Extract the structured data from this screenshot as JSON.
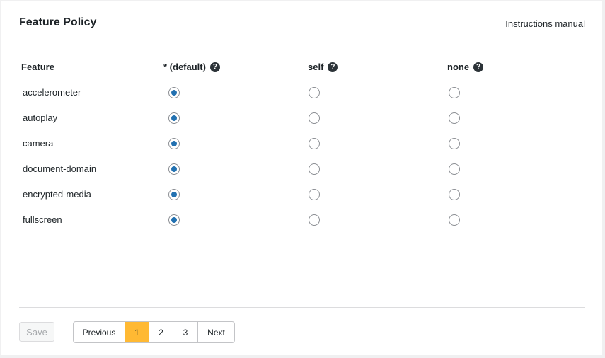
{
  "header": {
    "title": "Feature Policy",
    "manual_link": "Instructions manual"
  },
  "columns": {
    "feature": "Feature",
    "default": "* (default)",
    "self": "self",
    "none": "none",
    "help_icon": "help-icon"
  },
  "features": [
    {
      "name": "accelerometer",
      "selected": "default"
    },
    {
      "name": "autoplay",
      "selected": "default"
    },
    {
      "name": "camera",
      "selected": "default"
    },
    {
      "name": "document-domain",
      "selected": "default"
    },
    {
      "name": "encrypted-media",
      "selected": "default"
    },
    {
      "name": "fullscreen",
      "selected": "default"
    }
  ],
  "footer": {
    "save_label": "Save",
    "pagination": {
      "previous": "Previous",
      "pages": [
        "1",
        "2",
        "3"
      ],
      "current": "1",
      "next": "Next"
    }
  },
  "colors": {
    "accent": "#2271b1",
    "active_page": "#ffb933"
  }
}
